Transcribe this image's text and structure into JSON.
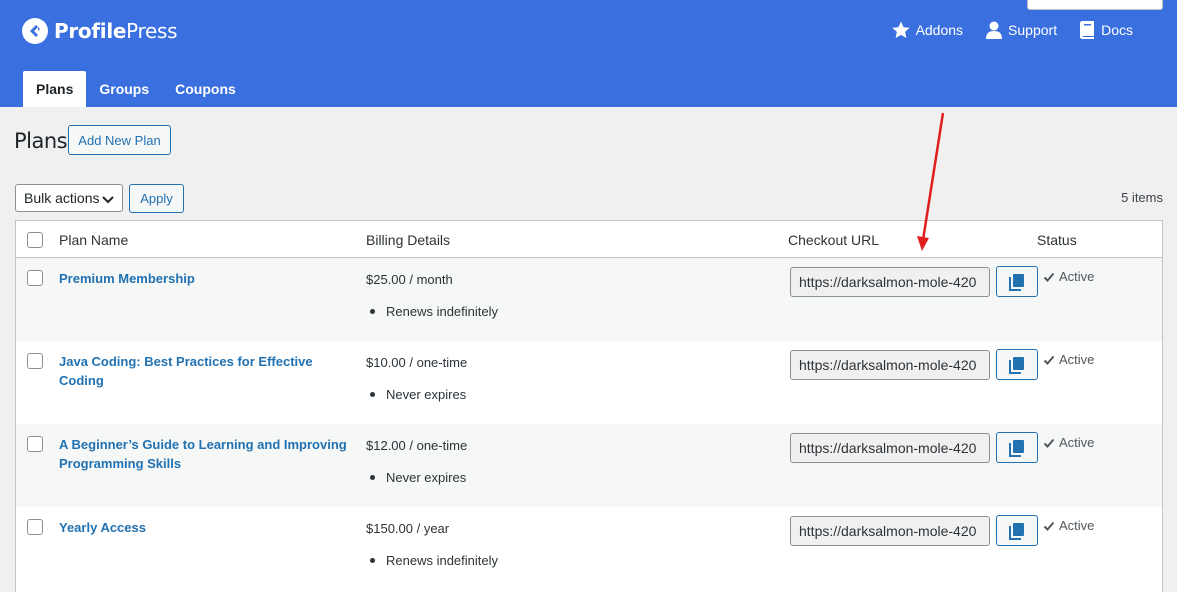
{
  "header": {
    "brand_bold": "Profile",
    "brand_light": "Press",
    "nav": [
      {
        "label": "Addons",
        "icon": "star-icon"
      },
      {
        "label": "Support",
        "icon": "user-icon"
      },
      {
        "label": "Docs",
        "icon": "book-icon"
      }
    ],
    "tabs": [
      {
        "label": "Plans",
        "active": true
      },
      {
        "label": "Groups",
        "active": false
      },
      {
        "label": "Coupons",
        "active": false
      }
    ]
  },
  "page": {
    "title": "Plans",
    "add_new_label": "Add New Plan",
    "bulk_actions_label": "Bulk actions",
    "apply_label": "Apply",
    "items_count": "5 items"
  },
  "table": {
    "columns": [
      "Plan Name",
      "Billing Details",
      "Checkout URL",
      "Status"
    ],
    "rows": [
      {
        "name": "Premium Membership",
        "price": "$25.00 / month",
        "detail": "Renews indefinitely",
        "url": "https://darksalmon-mole-420",
        "status": "Active"
      },
      {
        "name": "Java Coding: Best Practices for Effective Coding",
        "price": "$10.00 / one-time",
        "detail": "Never expires",
        "url": "https://darksalmon-mole-420",
        "status": "Active"
      },
      {
        "name": "A Beginner’s Guide to Learning and Improving Programming Skills",
        "price": "$12.00 / one-time",
        "detail": "Never expires",
        "url": "https://darksalmon-mole-420",
        "status": "Active"
      },
      {
        "name": "Yearly Access",
        "price": "$150.00 / year",
        "detail": "Renews indefinitely",
        "url": "https://darksalmon-mole-420",
        "status": "Active"
      }
    ]
  },
  "colors": {
    "header_bg": "#3a6fe0",
    "link": "#2271b1",
    "annotation_arrow": "#e01e1e"
  }
}
